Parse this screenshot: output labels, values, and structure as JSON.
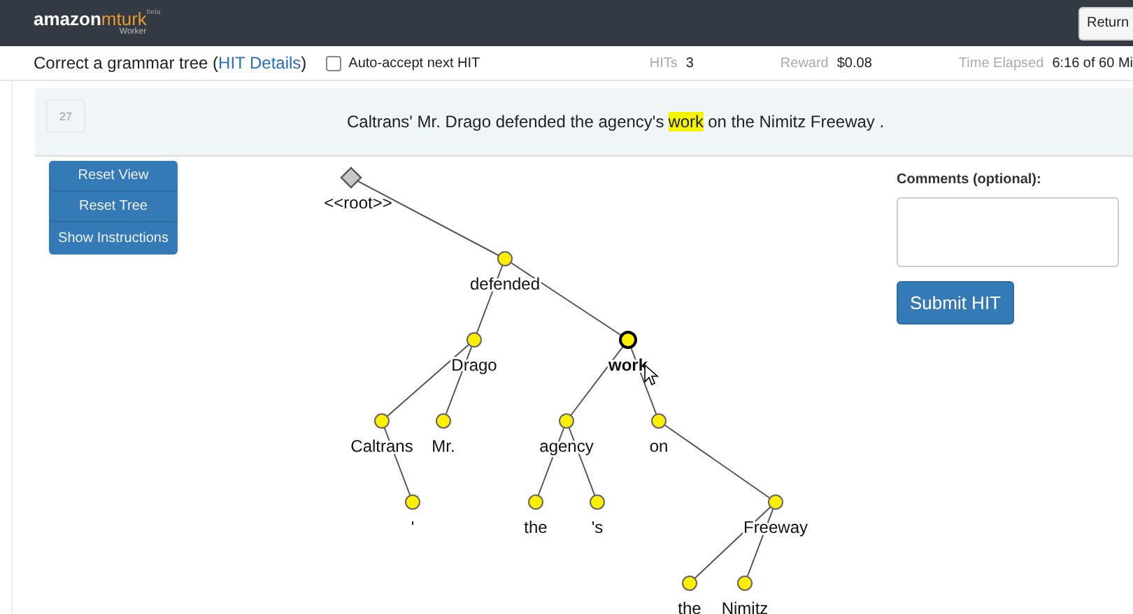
{
  "header": {
    "logo_word": "amazon",
    "logo_brand": "mturk",
    "logo_tag": "beta",
    "logo_sub": "Worker",
    "return_button": "Return"
  },
  "info_bar": {
    "title": "Correct a grammar tree",
    "open_paren": "(",
    "details_link": "HIT Details",
    "close_paren": ")",
    "auto_accept": {
      "label": "Auto-accept next HIT",
      "checked": false
    },
    "stats": [
      {
        "label": "HITs",
        "value": "3"
      },
      {
        "label": "Reward",
        "value": "$0.08"
      },
      {
        "label": "Time Elapsed",
        "value": "6:16 of 60 Mi"
      }
    ]
  },
  "sentence_panel": {
    "badge": "27",
    "text_before": "Caltrans' Mr. Drago defended the agency's",
    "highlighted_word": "work",
    "text_after": "on the Nimitz Freeway ."
  },
  "tool_buttons": [
    "Reset View",
    "Reset Tree",
    "Show Instructions"
  ],
  "tree": {
    "word": "<<root>>",
    "kind": "root",
    "selected": false,
    "children_right": [
      {
        "word": "defended",
        "selected": false,
        "children_left": [
          {
            "word": "Drago",
            "selected": false,
            "children_left": [
              {
                "word": "Caltrans",
                "selected": false,
                "children_right": [
                  {
                    "word": "'",
                    "selected": false
                  }
                ]
              },
              {
                "word": "Mr.",
                "selected": false
              }
            ]
          }
        ],
        "children_right": [
          {
            "word": "work",
            "selected": true,
            "children_left": [
              {
                "word": "agency",
                "selected": false,
                "children_left": [
                  {
                    "word": "the",
                    "selected": false
                  }
                ],
                "children_right": [
                  {
                    "word": "'s",
                    "selected": false
                  }
                ]
              }
            ],
            "children_right": [
              {
                "word": "on",
                "selected": false,
                "children_right": [
                  {
                    "word": "Freeway",
                    "selected": false,
                    "children_left": [
                      {
                        "word": "the",
                        "selected": false
                      },
                      {
                        "word": "Nimitz",
                        "selected": false
                      }
                    ]
                  }
                ]
              }
            ]
          }
        ]
      }
    ]
  },
  "comments": {
    "label": "Comments (optional):"
  },
  "submit_button": "Submit HIT"
}
